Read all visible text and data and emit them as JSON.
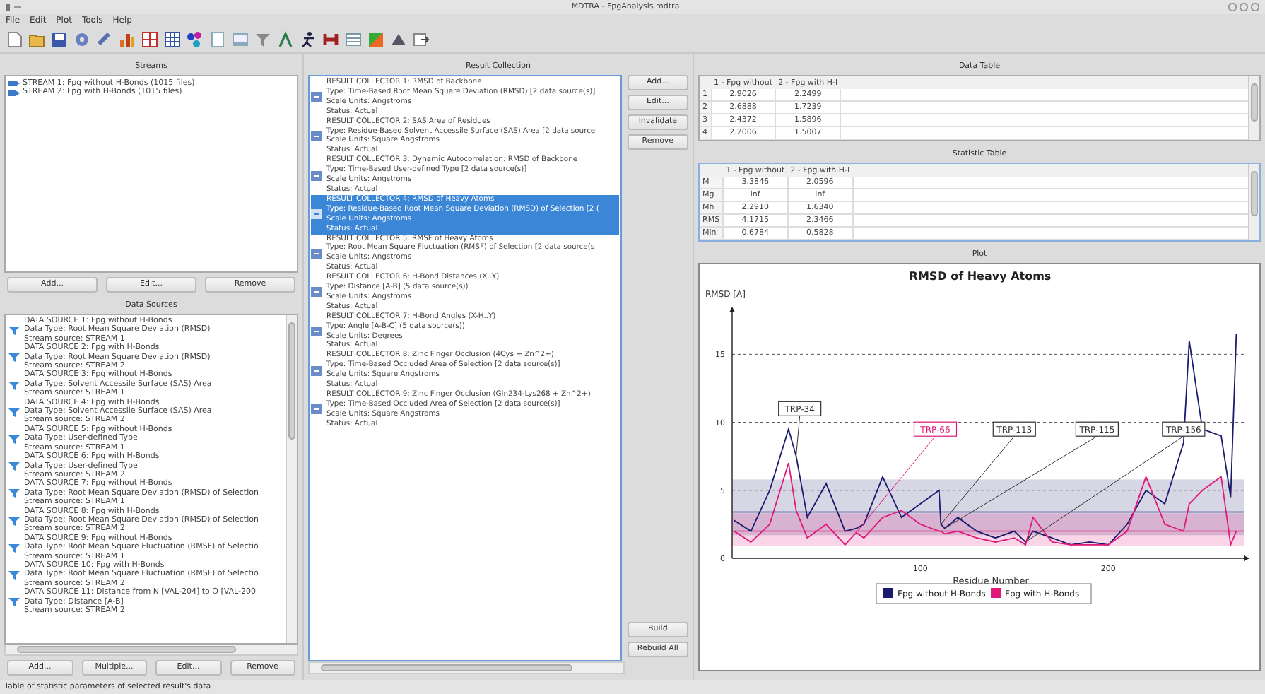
{
  "window": {
    "title": "MDTRA - FpgAnalysis.mdtra"
  },
  "menu": [
    "File",
    "Edit",
    "Plot",
    "Tools",
    "Help"
  ],
  "streams": {
    "title": "Streams",
    "items": [
      {
        "label": "STREAM 1: Fpg without H-Bonds (1015 files)"
      },
      {
        "label": "STREAM 2: Fpg with H-Bonds (1015 files)"
      }
    ],
    "buttons": [
      "Add...",
      "Edit...",
      "Remove"
    ]
  },
  "data_sources": {
    "title": "Data Sources",
    "items": [
      {
        "title": "DATA SOURCE 1: Fpg without H-Bonds",
        "type": "Data Type: Root Mean Square Deviation (RMSD)",
        "stream": "Stream source: STREAM 1"
      },
      {
        "title": "DATA SOURCE 2: Fpg with H-Bonds",
        "type": "Data Type: Root Mean Square Deviation (RMSD)",
        "stream": "Stream source: STREAM 2"
      },
      {
        "title": "DATA SOURCE 3: Fpg without H-Bonds",
        "type": "Data Type: Solvent Accessile Surface (SAS) Area",
        "stream": "Stream source: STREAM 1"
      },
      {
        "title": "DATA SOURCE 4: Fpg with H-Bonds",
        "type": "Data Type: Solvent Accessile Surface (SAS) Area",
        "stream": "Stream source: STREAM 2"
      },
      {
        "title": "DATA SOURCE 5: Fpg without H-Bonds",
        "type": "Data Type: User-defined Type",
        "stream": "Stream source: STREAM 1"
      },
      {
        "title": "DATA SOURCE 6: Fpg with H-Bonds",
        "type": "Data Type: User-defined Type",
        "stream": "Stream source: STREAM 2"
      },
      {
        "title": "DATA SOURCE 7: Fpg without H-Bonds",
        "type": "Data Type: Root Mean Square Deviation (RMSD) of Selection",
        "stream": "Stream source: STREAM 1"
      },
      {
        "title": "DATA SOURCE 8: Fpg with H-Bonds",
        "type": "Data Type: Root Mean Square Deviation (RMSD) of Selection",
        "stream": "Stream source: STREAM 2"
      },
      {
        "title": "DATA SOURCE 9: Fpg without H-Bonds",
        "type": "Data Type: Root Mean Square Fluctuation (RMSF) of Selectio",
        "stream": "Stream source: STREAM 1"
      },
      {
        "title": "DATA SOURCE 10: Fpg with H-Bonds",
        "type": "Data Type: Root Mean Square Fluctuation (RMSF) of Selectio",
        "stream": "Stream source: STREAM 2"
      },
      {
        "title": "DATA SOURCE 11: Distance from N [VAL-204] to O [VAL-200",
        "type": "Data Type: Distance [A-B]",
        "stream": "Stream source: STREAM 2"
      }
    ],
    "buttons": [
      "Add...",
      "Multiple...",
      "Edit...",
      "Remove"
    ]
  },
  "result_collection": {
    "title": "Result Collection",
    "items": [
      {
        "title": "RESULT COLLECTOR 1: RMSD of Backbone",
        "type": "Type: Time-Based Root Mean Square Deviation (RMSD) [2 data source(s)]",
        "units": "Scale Units: Angstroms",
        "status": "Status: Actual",
        "selected": false
      },
      {
        "title": "RESULT COLLECTOR 2: SAS Area of Residues",
        "type": "Type: Residue-Based Solvent Accessile Surface (SAS) Area [2 data source",
        "units": "Scale Units: Square Angstroms",
        "status": "Status: Actual",
        "selected": false
      },
      {
        "title": "RESULT COLLECTOR 3: Dynamic Autocorrelation: RMSD of Backbone",
        "type": "Type: Time-Based User-defined Type [2 data source(s)]",
        "units": "Scale Units: Angstroms",
        "status": "Status: Actual",
        "selected": false
      },
      {
        "title": "RESULT COLLECTOR 4: RMSD of Heavy Atoms",
        "type": "Type: Residue-Based Root Mean Square Deviation (RMSD) of Selection [2 (",
        "units": "Scale Units: Angstroms",
        "status": "Status: Actual",
        "selected": true
      },
      {
        "title": "RESULT COLLECTOR 5: RMSF of Heavy Atoms",
        "type": "Type: Root Mean Square Fluctuation (RMSF) of Selection [2 data source(s",
        "units": "Scale Units: Angstroms",
        "status": "Status: Actual",
        "selected": false
      },
      {
        "title": "RESULT COLLECTOR 6: H-Bond Distances (X..Y)",
        "type": "Type: Distance [A-B] (5 data source(s))",
        "units": "Scale Units: Angstroms",
        "status": "Status: Actual",
        "selected": false
      },
      {
        "title": "RESULT COLLECTOR 7: H-Bond Angles (X-H..Y)",
        "type": "Type: Angle [A-B-C] (5 data source(s))",
        "units": "Scale Units: Degrees",
        "status": "Status: Actual",
        "selected": false
      },
      {
        "title": "RESULT COLLECTOR 8: Zinc Finger Occlusion (4Cys + Zn^2+)",
        "type": "Type: Time-Based Occluded Area of Selection [2 data source(s)]",
        "units": "Scale Units: Square Angstroms",
        "status": "Status: Actual",
        "selected": false
      },
      {
        "title": "RESULT COLLECTOR 9: Zinc Finger Occlusion (Gln234-Lys268 + Zn^2+)",
        "type": "Type: Time-Based Occluded Area of Selection [2 data source(s)]",
        "units": "Scale Units: Square Angstroms",
        "status": "Status: Actual",
        "selected": false
      }
    ],
    "buttons": [
      "Add...",
      "Edit...",
      "Invalidate",
      "Remove"
    ],
    "build_buttons": [
      "Build",
      "Rebuild All"
    ]
  },
  "data_table": {
    "title": "Data Table",
    "columns": [
      "1 - Fpg without",
      "2 - Fpg with H-I"
    ],
    "rows": [
      {
        "label": "1",
        "cells": [
          "2.9026",
          "2.2499"
        ]
      },
      {
        "label": "2",
        "cells": [
          "2.6888",
          "1.7239"
        ]
      },
      {
        "label": "3",
        "cells": [
          "2.4372",
          "1.5896"
        ]
      },
      {
        "label": "4",
        "cells": [
          "2.2006",
          "1.5007"
        ]
      }
    ]
  },
  "statistic_table": {
    "title": "Statistic Table",
    "columns": [
      "1 - Fpg without",
      "2 - Fpg with H-I"
    ],
    "rows": [
      {
        "label": "M",
        "cells": [
          "3.3846",
          "2.0596"
        ]
      },
      {
        "label": "Mg",
        "cells": [
          "inf",
          "inf"
        ]
      },
      {
        "label": "Mh",
        "cells": [
          "2.2910",
          "1.6340"
        ]
      },
      {
        "label": "RMS",
        "cells": [
          "4.1715",
          "2.3466"
        ]
      },
      {
        "label": "Min",
        "cells": [
          "0.6784",
          "0.5828"
        ]
      }
    ]
  },
  "plot": {
    "title": "Plot",
    "chart_data": {
      "type": "line",
      "title": "RMSD of Heavy Atoms",
      "xlabel": "Residue Number",
      "ylabel": "RMSD [A]",
      "x": [
        1,
        10,
        20,
        30,
        34,
        40,
        50,
        60,
        66,
        70,
        80,
        90,
        100,
        110,
        111,
        113,
        120,
        130,
        140,
        150,
        156,
        160,
        170,
        180,
        190,
        200,
        210,
        220,
        230,
        240,
        243,
        250,
        260,
        265,
        268
      ],
      "series": [
        {
          "name": "Fpg without H-Bonds",
          "color": "#1a1a6e",
          "values": [
            2.8,
            2.0,
            5.0,
            9.5,
            7.5,
            3.0,
            5.5,
            2.0,
            2.2,
            2.5,
            6.0,
            3.0,
            4.0,
            5.0,
            2.5,
            2.2,
            3.0,
            2.0,
            1.5,
            2.0,
            1.2,
            2.0,
            1.5,
            1.0,
            1.2,
            1.0,
            2.5,
            5.0,
            4.0,
            8.5,
            16.0,
            9.5,
            9.0,
            4.5,
            16.5
          ]
        },
        {
          "name": "Fpg with H-Bonds",
          "color": "#e0187a",
          "values": [
            2.0,
            1.2,
            2.5,
            7.0,
            3.5,
            1.5,
            2.5,
            1.0,
            1.9,
            1.5,
            3.0,
            3.5,
            2.5,
            2.0,
            2.0,
            1.8,
            2.0,
            1.5,
            1.2,
            1.5,
            1.0,
            3.0,
            1.2,
            1.0,
            1.0,
            1.0,
            2.0,
            6.0,
            2.5,
            2.0,
            4.0,
            5.0,
            6.0,
            1.0,
            2.0
          ]
        }
      ],
      "xlim": [
        0,
        275
      ],
      "ylim": [
        0,
        18.5
      ],
      "xticks": [
        100,
        200
      ],
      "yticks": [
        0,
        5,
        10,
        15
      ],
      "grid": true,
      "legend": true,
      "bands": [
        {
          "axis": "y",
          "from": 1.7,
          "to": 5.8,
          "color": "#1a1a6e"
        },
        {
          "axis": "y",
          "from": 0.9,
          "to": 3.3,
          "color": "#e0187a"
        }
      ],
      "ref_lines": [
        {
          "axis": "y",
          "value": 3.4,
          "color": "#1a1a6e"
        },
        {
          "axis": "y",
          "value": 2.0,
          "color": "#e0187a"
        }
      ],
      "annotations": [
        {
          "text": "TRP-34",
          "x": 34,
          "y": 7.5
        },
        {
          "text": "TRP-66",
          "x": 66,
          "y": 1.9
        },
        {
          "text": "TRP-113",
          "x": 111,
          "y": 2.5
        },
        {
          "text": "TRP-115",
          "x": 113,
          "y": 2.2
        },
        {
          "text": "TRP-156",
          "x": 156,
          "y": 1.2
        }
      ]
    }
  },
  "status_bar": "Table of statistic parameters of selected result's data"
}
